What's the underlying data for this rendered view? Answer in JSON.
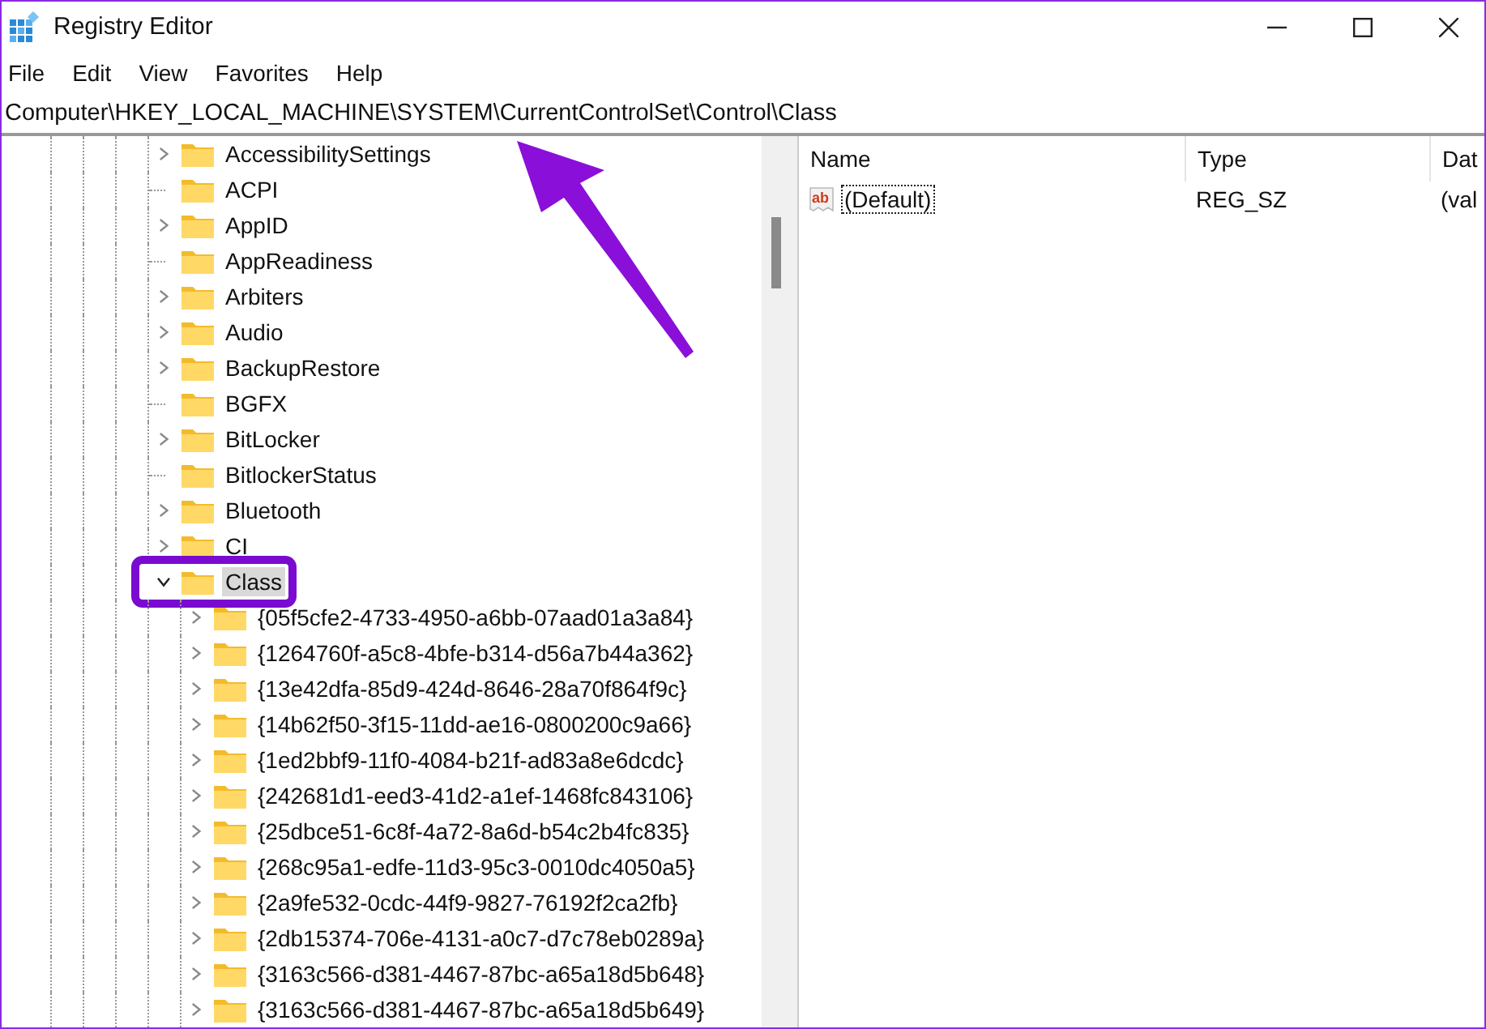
{
  "window": {
    "title": "Registry Editor"
  },
  "menu": [
    "File",
    "Edit",
    "View",
    "Favorites",
    "Help"
  ],
  "address": "Computer\\HKEY_LOCAL_MACHINE\\SYSTEM\\CurrentControlSet\\Control\\Class",
  "tree": [
    {
      "label": "AccessibilitySettings",
      "expandable": true,
      "expanded": false,
      "selected": false
    },
    {
      "label": "ACPI",
      "expandable": false,
      "selected": false
    },
    {
      "label": "AppID",
      "expandable": true,
      "expanded": false,
      "selected": false
    },
    {
      "label": "AppReadiness",
      "expandable": false,
      "selected": false
    },
    {
      "label": "Arbiters",
      "expandable": true,
      "expanded": false,
      "selected": false
    },
    {
      "label": "Audio",
      "expandable": true,
      "expanded": false,
      "selected": false
    },
    {
      "label": "BackupRestore",
      "expandable": true,
      "expanded": false,
      "selected": false
    },
    {
      "label": "BGFX",
      "expandable": false,
      "selected": false
    },
    {
      "label": "BitLocker",
      "expandable": true,
      "expanded": false,
      "selected": false
    },
    {
      "label": "BitlockerStatus",
      "expandable": false,
      "selected": false
    },
    {
      "label": "Bluetooth",
      "expandable": true,
      "expanded": false,
      "selected": false
    },
    {
      "label": "CI",
      "expandable": true,
      "expanded": false,
      "selected": false
    },
    {
      "label": "Class",
      "expandable": true,
      "expanded": true,
      "selected": true,
      "highlighted": true,
      "children": [
        {
          "label": "{05f5cfe2-4733-4950-a6bb-07aad01a3a84}",
          "expandable": true,
          "expanded": false,
          "selected": false
        },
        {
          "label": "{1264760f-a5c8-4bfe-b314-d56a7b44a362}",
          "expandable": true,
          "expanded": false,
          "selected": false
        },
        {
          "label": "{13e42dfa-85d9-424d-8646-28a70f864f9c}",
          "expandable": true,
          "expanded": false,
          "selected": false
        },
        {
          "label": "{14b62f50-3f15-11dd-ae16-0800200c9a66}",
          "expandable": true,
          "expanded": false,
          "selected": false
        },
        {
          "label": "{1ed2bbf9-11f0-4084-b21f-ad83a8e6dcdc}",
          "expandable": true,
          "expanded": false,
          "selected": false
        },
        {
          "label": "{242681d1-eed3-41d2-a1ef-1468fc843106}",
          "expandable": true,
          "expanded": false,
          "selected": false
        },
        {
          "label": "{25dbce51-6c8f-4a72-8a6d-b54c2b4fc835}",
          "expandable": true,
          "expanded": false,
          "selected": false
        },
        {
          "label": "{268c95a1-edfe-11d3-95c3-0010dc4050a5}",
          "expandable": true,
          "expanded": false,
          "selected": false
        },
        {
          "label": "{2a9fe532-0cdc-44f9-9827-76192f2ca2fb}",
          "expandable": true,
          "expanded": false,
          "selected": false
        },
        {
          "label": "{2db15374-706e-4131-a0c7-d7c78eb0289a}",
          "expandable": true,
          "expanded": false,
          "selected": false
        },
        {
          "label": "{3163c566-d381-4467-87bc-a65a18d5b648}",
          "expandable": true,
          "expanded": false,
          "selected": false
        },
        {
          "label": "{3163c566-d381-4467-87bc-a65a18d5b649}",
          "expandable": true,
          "expanded": false,
          "selected": false
        }
      ]
    }
  ],
  "values": {
    "columns": [
      "Name",
      "Type",
      "Dat"
    ],
    "rows": [
      {
        "icon_text": "ab",
        "name": "(Default)",
        "type": "REG_SZ",
        "data": "(val",
        "focused": true
      }
    ]
  },
  "annotation": {
    "kind": "arrow"
  }
}
